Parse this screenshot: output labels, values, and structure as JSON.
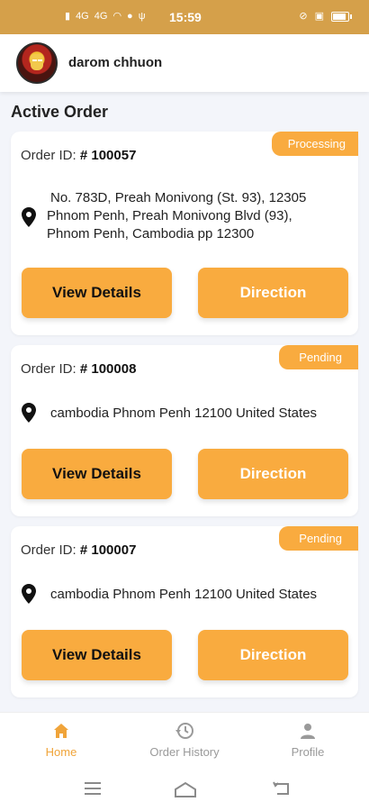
{
  "status_bar": {
    "time": "15:59",
    "signal1": "4G",
    "signal2": "4G",
    "battery": "100"
  },
  "header": {
    "user_name": "darom chhuon"
  },
  "section_title": "Active Order",
  "orders": [
    {
      "status": "Processing",
      "id_label": "Order ID:",
      "id_value": "# 100057",
      "address_lines": [
        "No. 783D, Preah Monivong (St. 93), 12305",
        "Phnom Penh, Preah Monivong Blvd (93),",
        "Phnom Penh, Cambodia pp  12300"
      ],
      "view_label": "View Details",
      "direction_label": "Direction"
    },
    {
      "status": "Pending",
      "id_label": "Order ID:",
      "id_value": "# 100008",
      "address_lines": [
        "cambodia Phnom Penh  12100 United States"
      ],
      "view_label": "View Details",
      "direction_label": "Direction"
    },
    {
      "status": "Pending",
      "id_label": "Order ID:",
      "id_value": "# 100007",
      "address_lines": [
        "cambodia Phnom Penh  12100 United States"
      ],
      "view_label": "View Details",
      "direction_label": "Direction"
    }
  ],
  "bottom_nav": {
    "items": [
      {
        "label": "Home",
        "icon": "home-icon",
        "active": true
      },
      {
        "label": "Order History",
        "icon": "history-icon",
        "active": false
      },
      {
        "label": "Profile",
        "icon": "profile-icon",
        "active": false
      }
    ]
  },
  "colors": {
    "accent": "#f9ab3f",
    "status_bar": "#d5a04a",
    "active_nav": "#f0a43a"
  }
}
